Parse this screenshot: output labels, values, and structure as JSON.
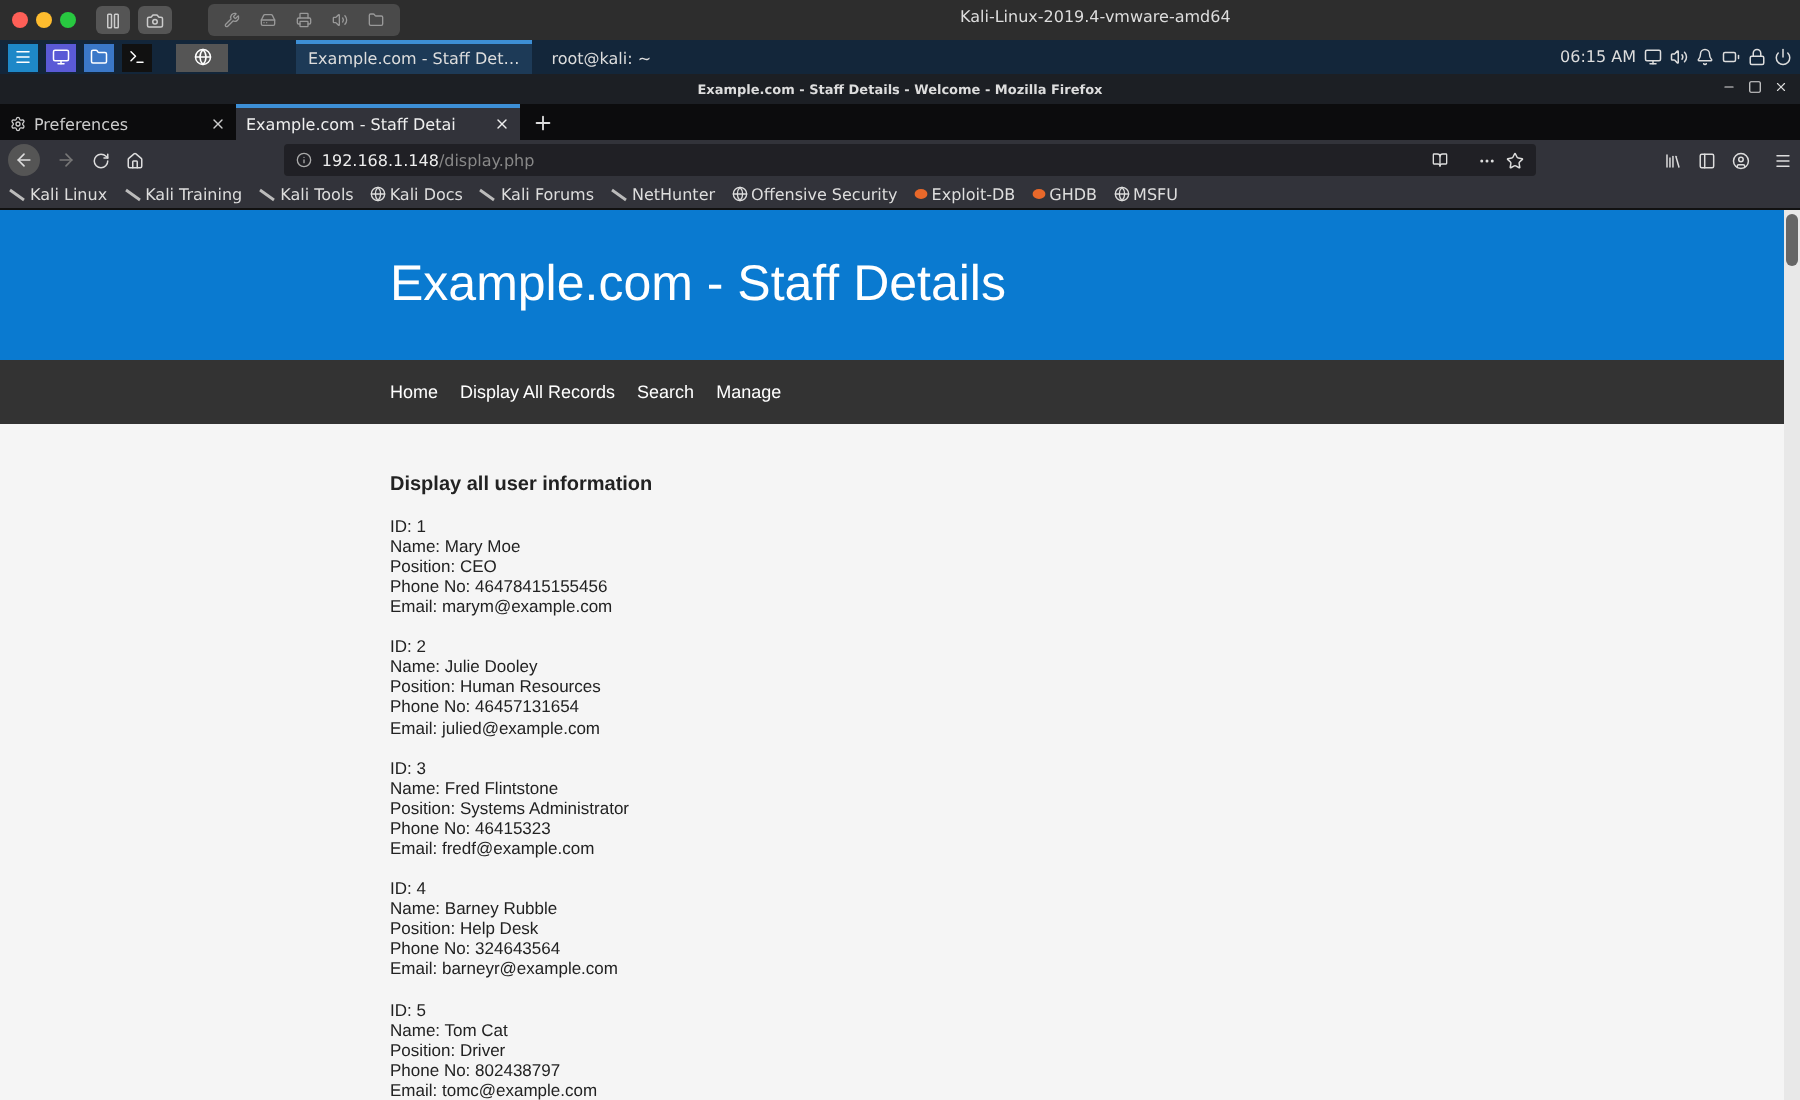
{
  "host_window": {
    "title": "Kali-Linux-2019.4-vmware-amd64"
  },
  "panel": {
    "tasks": [
      {
        "label": "Example.com - Staff Det…",
        "selected": true
      },
      {
        "label": "root@kali: ~",
        "selected": false
      }
    ],
    "clock": "06:15 AM"
  },
  "firefox": {
    "title": "Example.com - Staff Details - Welcome - Mozilla Firefox",
    "tabs": [
      {
        "label": "Preferences",
        "selected": false,
        "kind": "settings"
      },
      {
        "label": "Example.com - Staff Detai",
        "selected": true,
        "kind": "page"
      }
    ],
    "url_host": "192.168.1.148",
    "url_path": "/display.php",
    "bookmarks": [
      {
        "label": "Kali Linux",
        "kind": "kali"
      },
      {
        "label": "Kali Training",
        "kind": "kali"
      },
      {
        "label": "Kali Tools",
        "kind": "kali"
      },
      {
        "label": "Kali Docs",
        "kind": "globe"
      },
      {
        "label": "Kali Forums",
        "kind": "kali"
      },
      {
        "label": "NetHunter",
        "kind": "kali"
      },
      {
        "label": "Offensive Security",
        "kind": "globe"
      },
      {
        "label": "Exploit-DB",
        "kind": "exploit"
      },
      {
        "label": "GHDB",
        "kind": "exploit"
      },
      {
        "label": "MSFU",
        "kind": "globe"
      }
    ]
  },
  "page": {
    "site_title": "Example.com - Staff Details",
    "nav": [
      "Home",
      "Display All Records",
      "Search",
      "Manage"
    ],
    "heading": "Display all user information",
    "records": [
      {
        "lines": [
          "ID: 1",
          "Name: Mary Moe",
          "Position: CEO",
          "Phone No: 46478415155456",
          "Email: marym@example.com"
        ]
      },
      {
        "lines": [
          "ID: 2",
          "Name: Julie Dooley",
          "Position: Human Resources",
          "Phone No: 46457131654",
          "Email: julied@example.com"
        ]
      },
      {
        "lines": [
          "ID: 3",
          "Name: Fred Flintstone",
          "Position: Systems Administrator",
          "Phone No: 46415323",
          "Email: fredf@example.com"
        ]
      },
      {
        "lines": [
          "ID: 4",
          "Name: Barney Rubble",
          "Position: Help Desk",
          "Phone No: 324643564",
          "Email: barneyr@example.com"
        ]
      },
      {
        "lines": [
          "ID: 5",
          "Name: Tom Cat",
          "Position: Driver",
          "Phone No: 802438797",
          "Email: tomc@example.com"
        ]
      }
    ]
  }
}
